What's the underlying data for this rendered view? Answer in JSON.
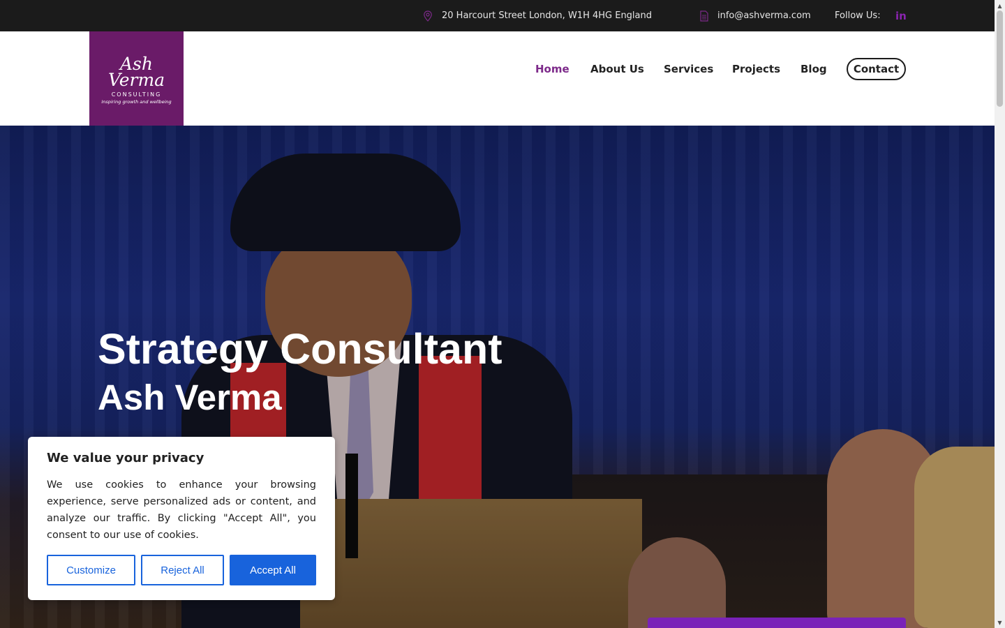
{
  "topbar": {
    "address": "20 Harcourt Street London, W1H 4HG England",
    "email": "info@ashverma.com",
    "follow_label": "Follow Us:",
    "linkedin_glyph": "in",
    "icon_names": [
      "map-pin-icon",
      "document-icon",
      "linkedin-icon"
    ],
    "background_color": "#1b1b1b"
  },
  "logo": {
    "line1": "Ash",
    "line2": "Verma",
    "line3": "CONSULTING",
    "tagline": "Inspiring growth and wellbeing",
    "background_color": "#6a1b68"
  },
  "nav": {
    "items": [
      {
        "label": "Home",
        "active": true
      },
      {
        "label": "About Us",
        "active": false
      },
      {
        "label": "Services",
        "active": false
      },
      {
        "label": "Projects",
        "active": false
      },
      {
        "label": "Blog",
        "active": false
      }
    ],
    "contact_label": "Contact",
    "active_color": "#7d2a8a"
  },
  "hero": {
    "title": "Strategy Consultant",
    "subtitle": "Ash Verma",
    "accent_color": "#7a22b8"
  },
  "cookie_banner": {
    "title": "We value your privacy",
    "text": "We use cookies to enhance your browsing experience, serve personalized ads or content, and analyze our traffic. By clicking \"Accept All\", you consent to our use of cookies.",
    "customize_label": "Customize",
    "reject_label": "Reject All",
    "accept_label": "Accept All",
    "button_color": "#1863dc"
  }
}
